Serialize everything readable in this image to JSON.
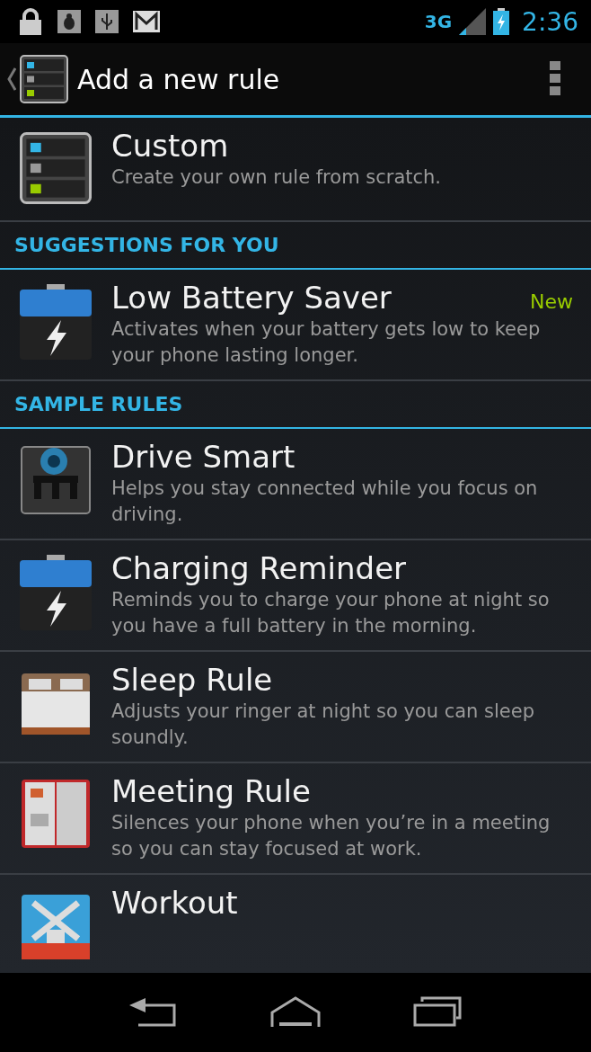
{
  "status_bar": {
    "network": "3G",
    "time": "2:36"
  },
  "action_bar": {
    "title": "Add a new rule"
  },
  "sections": [
    {
      "items": [
        {
          "kind": "custom",
          "title": "Custom",
          "description": "Create your own rule from scratch."
        }
      ]
    },
    {
      "header": "SUGGESTIONS FOR YOU",
      "items": [
        {
          "kind": "battery",
          "title": "Low Battery Saver",
          "description": "Activates when your battery gets low to keep your phone lasting longer.",
          "badge": "New"
        }
      ]
    },
    {
      "header": "SAMPLE RULES",
      "items": [
        {
          "kind": "car",
          "title": "Drive Smart",
          "description": "Helps you stay connected while you focus on driving."
        },
        {
          "kind": "battery",
          "title": "Charging Reminder",
          "description": "Reminds you to charge your phone at night so you have a full battery in the morning."
        },
        {
          "kind": "bed",
          "title": "Sleep Rule",
          "description": "Adjusts your ringer at night so you can sleep soundly."
        },
        {
          "kind": "calendar",
          "title": "Meeting Rule",
          "description": "Silences your phone when you’re in a meeting so you can stay focused at work."
        },
        {
          "kind": "shoe",
          "title": "Workout"
        }
      ]
    }
  ]
}
